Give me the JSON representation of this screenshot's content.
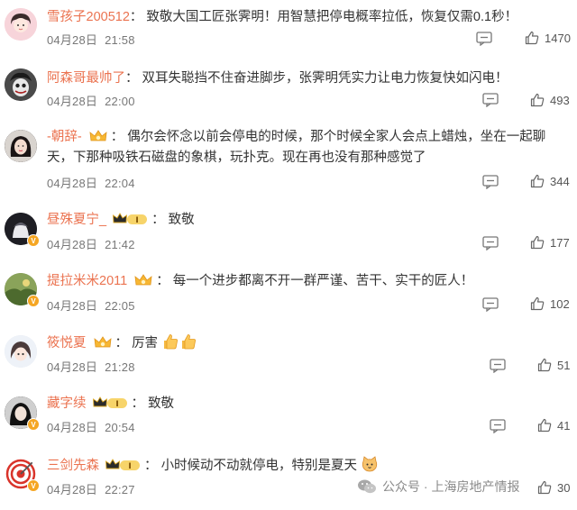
{
  "comments": [
    {
      "username": "雪孩子200512",
      "text": "致敬大国工匠张霁明！用智慧把停电概率拉低，恢复仅需0.1秒！",
      "date": "04月28日",
      "time": "21:58",
      "likes": "1470",
      "avatar_color": "#f4c7cf"
    },
    {
      "username": "阿森哥最帅了",
      "text": "双耳失聪挡不住奋进脚步，张霁明凭实力让电力恢复快如闪电！",
      "date": "04月28日",
      "time": "22:00",
      "likes": "493",
      "avatar_color": "#3b3b3b"
    },
    {
      "username": "-朝辞-",
      "text": "偶尔会怀念以前会停电的时候，那个时候全家人会点上蜡烛，坐在一起聊天，下那种吸铁石磁盘的象棋，玩扑克。现在再也没有那种感觉了",
      "date": "04月28日",
      "time": "22:04",
      "likes": "344",
      "avatar_color": "#2f2a2a"
    },
    {
      "username": "昼殊夏宁_",
      "text": "致敬",
      "date": "04月28日",
      "time": "21:42",
      "likes": "177",
      "avatar_color": "#1e1e24"
    },
    {
      "username": "提拉米米2011",
      "text": "每一个进步都离不开一群严谨、苦干、实干的匠人！",
      "date": "04月28日",
      "time": "22:05",
      "likes": "102",
      "avatar_color": "#6f8a4a"
    },
    {
      "username": "筱悦夏",
      "text": "厉害",
      "date": "04月28日",
      "time": "21:28",
      "likes": "51",
      "avatar_color": "#dfe6f0"
    },
    {
      "username": "藏字续",
      "text": "致敬",
      "date": "04月28日",
      "time": "20:54",
      "likes": "41",
      "avatar_color": "#2c2c2c"
    },
    {
      "username": "三剑先森",
      "text": "小时候动不动就停电，特别是夏天",
      "date": "04月28日",
      "time": "22:27",
      "likes": "30",
      "avatar_color": "#ffffff"
    }
  ],
  "badge_level": "I",
  "watermark": "公众号 · 上海房地产情报",
  "colors": {
    "username": "#eb7350",
    "meta": "#777777",
    "vip_gold": "#f5a623"
  }
}
